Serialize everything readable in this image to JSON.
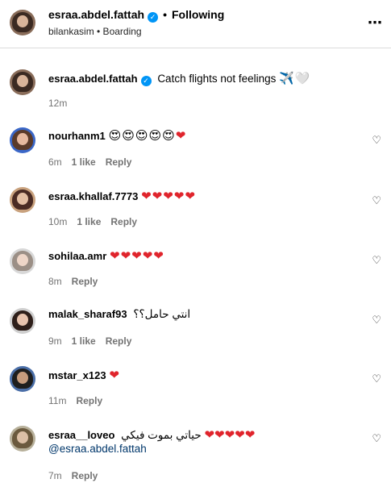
{
  "header": {
    "username": "esraa.abdel.fattah",
    "verified_mark": "✓",
    "separator": "•",
    "follow_status": "Following",
    "subtitle": "bilankasim • Boarding",
    "more_icon": "⋯"
  },
  "caption": {
    "username": "esraa.abdel.fattah",
    "verified_mark": "✓",
    "text": "Catch flights not feelings",
    "emoji": "✈️🤍",
    "time": "12m"
  },
  "comments": [
    {
      "username": "nourhanm1",
      "text": "",
      "emoji": "😍😍😍😍😍",
      "hearts": "❤",
      "time": "6m",
      "likes": "1 like",
      "reply": "Reply"
    },
    {
      "username": "esraa.khallaf.7773",
      "text": "",
      "emoji": "",
      "hearts": "❤❤❤❤❤",
      "time": "10m",
      "likes": "1 like",
      "reply": "Reply"
    },
    {
      "username": "sohilaa.amr",
      "text": "",
      "emoji": "",
      "hearts": "❤❤❤❤❤",
      "time": "8m",
      "likes": "",
      "reply": "Reply"
    },
    {
      "username": "malak_sharaf93",
      "text": "انتي حامل؟؟",
      "emoji": "",
      "hearts": "",
      "time": "9m",
      "likes": "1 like",
      "reply": "Reply"
    },
    {
      "username": "mstar_x123",
      "text": "",
      "emoji": "",
      "hearts": "❤",
      "time": "11m",
      "likes": "",
      "reply": "Reply"
    },
    {
      "username": "esraa__loveo",
      "text": "حياتي بموت فيكي",
      "emoji": "",
      "hearts": "❤❤❤❤❤",
      "mention": "@esraa.abdel.fattah",
      "time": "7m",
      "likes": "",
      "reply": "Reply"
    }
  ],
  "icons": {
    "like": "♡"
  }
}
